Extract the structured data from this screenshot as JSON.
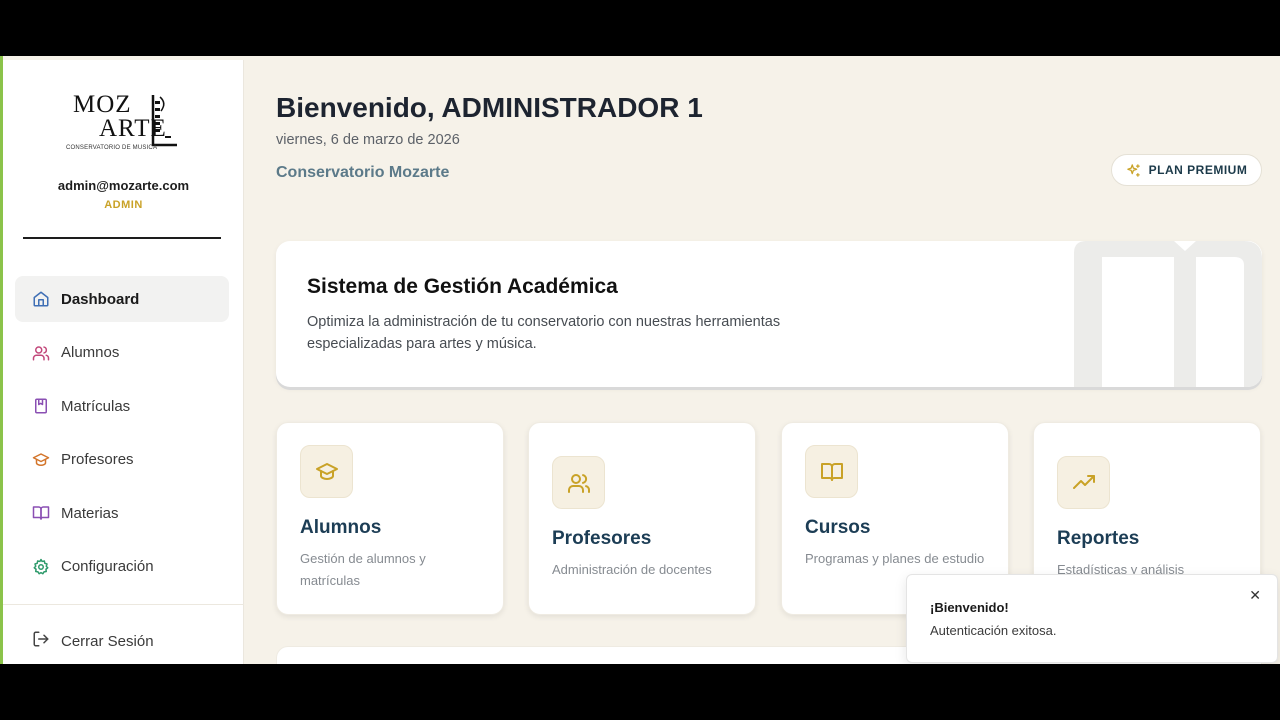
{
  "sidebar": {
    "logo": {
      "line1": "MOZ",
      "line2": "ARTE",
      "subtitle": "CONSERVATORIO DE MUSICA"
    },
    "user": {
      "email": "admin@mozarte.com",
      "role": "ADMIN"
    },
    "nav": [
      {
        "label": "Dashboard",
        "icon": "home-icon",
        "color": "#3f6fb5",
        "active": true
      },
      {
        "label": "Alumnos",
        "icon": "users-icon",
        "color": "#c2477a"
      },
      {
        "label": "Matrículas",
        "icon": "book-icon",
        "color": "#8a4fb3"
      },
      {
        "label": "Profesores",
        "icon": "graduation-cap-icon",
        "color": "#d3752b"
      },
      {
        "label": "Materias",
        "icon": "open-book-icon",
        "color": "#8a4fb3"
      },
      {
        "label": "Configuración",
        "icon": "gear-icon",
        "color": "#2e9a6b"
      }
    ],
    "logout": {
      "label": "Cerrar Sesión",
      "icon": "logout-icon"
    }
  },
  "header": {
    "welcome": "Bienvenido, ADMINISTRADOR 1",
    "date": "viernes, 6 de marzo de 2026",
    "organization": "Conservatorio Mozarte",
    "premium_label": "PLAN PREMIUM"
  },
  "hero": {
    "title": "Sistema de Gestión Académica",
    "description": "Optimiza la administración de tu conservatorio con nuestras herramientas especializadas para artes y música."
  },
  "cards": [
    {
      "title": "Alumnos",
      "description": "Gestión de alumnos y matrículas",
      "icon": "graduation-cap-icon"
    },
    {
      "title": "Profesores",
      "description": "Administración de docentes",
      "icon": "users-icon"
    },
    {
      "title": "Cursos",
      "description": "Programas y planes de estudio",
      "icon": "open-book-icon"
    },
    {
      "title": "Reportes",
      "description": "Estadísticas y análisis",
      "icon": "trending-up-icon"
    }
  ],
  "toast": {
    "title": "¡Bienvenido!",
    "message": "Autenticación exitosa.",
    "close_glyph": "✕"
  },
  "colors": {
    "page_bg": "#f6f2e9",
    "accent_gold": "#c9a227",
    "heading_navy": "#1c3d55",
    "org_slate": "#5c7a89"
  }
}
